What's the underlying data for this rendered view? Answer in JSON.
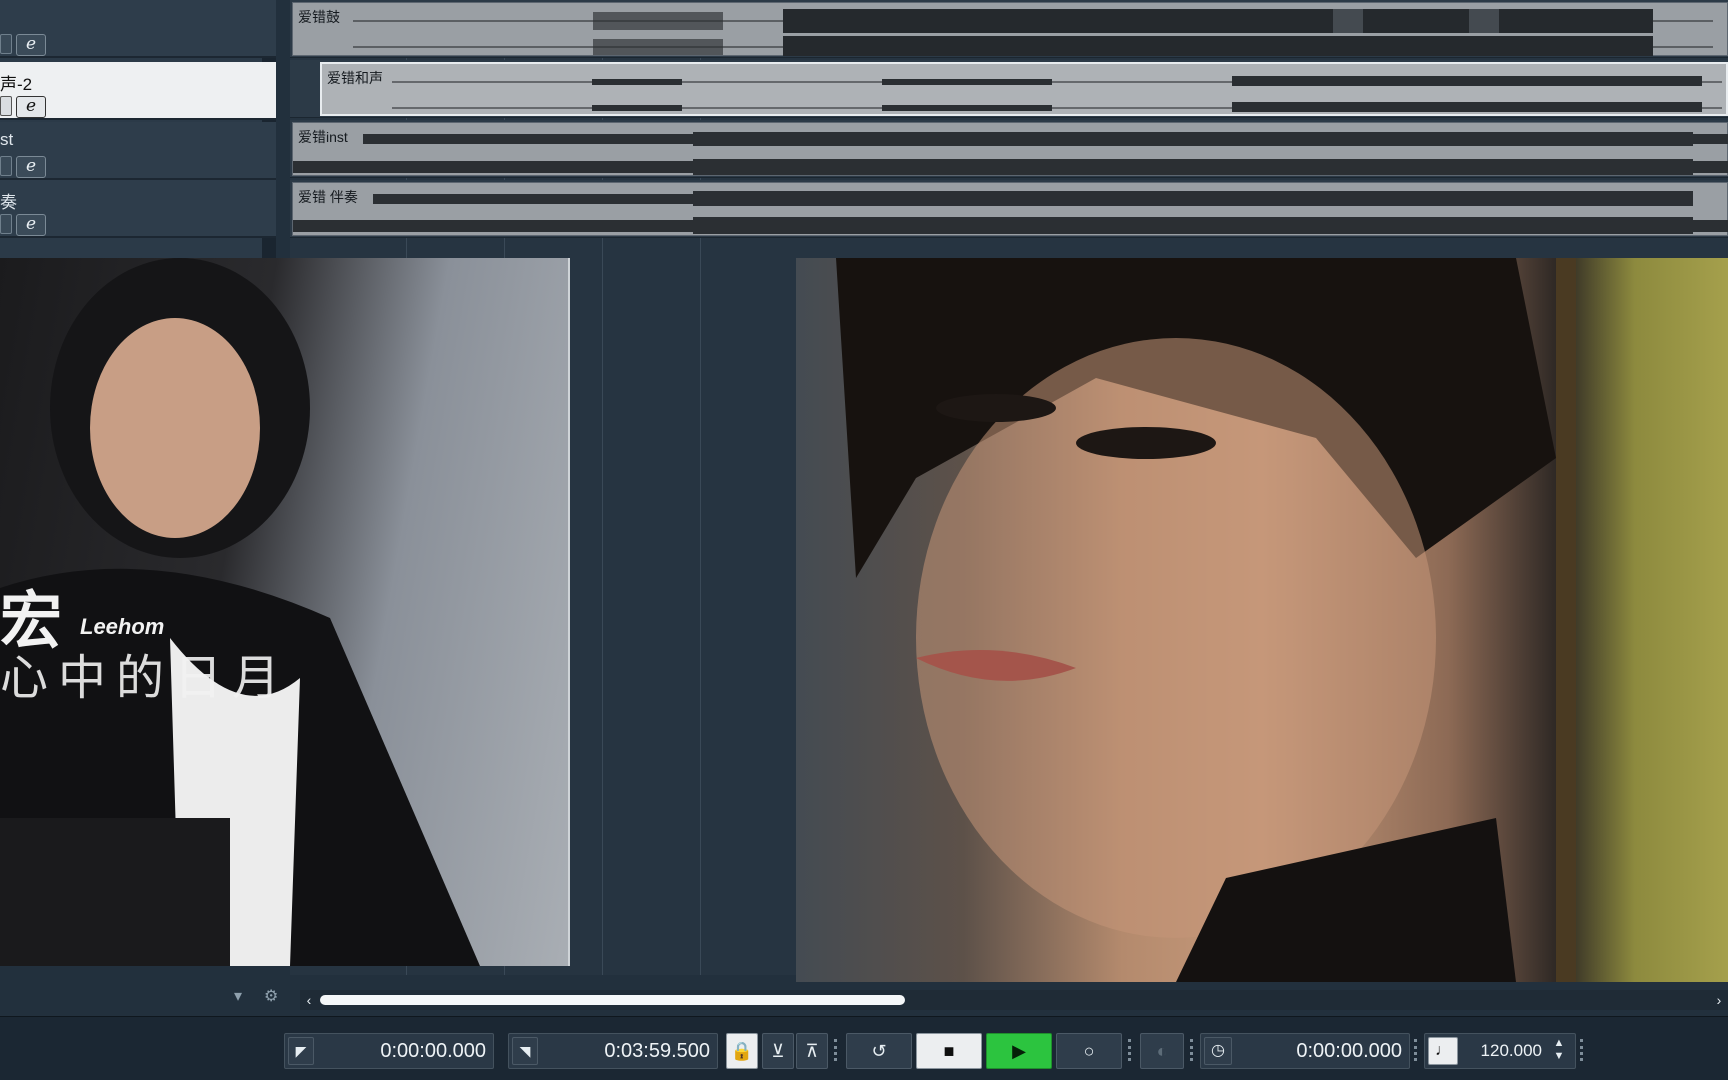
{
  "tracks": [
    {
      "name": ""
    },
    {
      "name": "声-2",
      "selected": true
    },
    {
      "name": "st"
    },
    {
      "name": "奏"
    }
  ],
  "edit_button_label": "e",
  "clips": [
    {
      "name": "爱错鼓"
    },
    {
      "name": "爱错和声"
    },
    {
      "name": "爱错inst"
    },
    {
      "name": "爱错 伴奏"
    }
  ],
  "overlay": {
    "artist_chinese": "宏",
    "artist_english": "Leehom",
    "album_script": "心中的日月"
  },
  "transport": {
    "left_locator": "0:00:00.000",
    "right_locator": "0:03:59.500",
    "time_display": "0:00:00.000",
    "tempo": "120.000"
  },
  "colors": {
    "play_active": "#2cc43f",
    "selected_track": "#eef0f2",
    "clip_bg": "#9a9fa4"
  },
  "icons": {
    "left_locator": "left-locator-icon",
    "right_locator": "right-locator-icon",
    "lock": "lock-icon",
    "cycle": "loop-icon",
    "stop": "stop-icon",
    "play": "play-icon",
    "record": "record-icon",
    "clock": "clock-icon",
    "metronome": "tempo-icon"
  }
}
